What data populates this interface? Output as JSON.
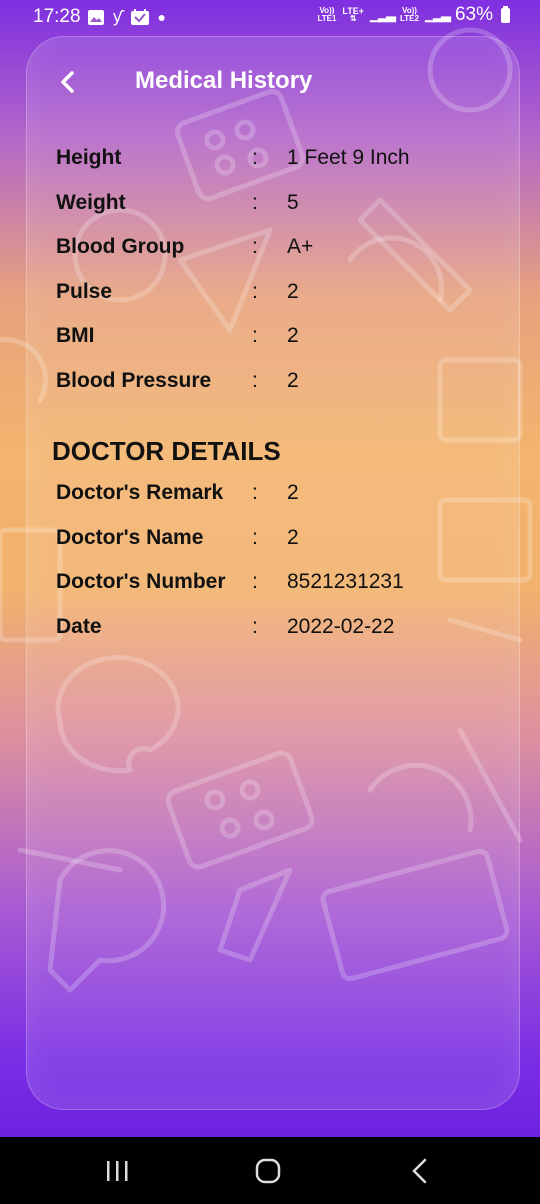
{
  "status_bar": {
    "time": "17:28",
    "left_icons": [
      "gallery-icon",
      "y-app-icon",
      "calendar-icon",
      "dot-icon"
    ],
    "net1_top": "Vo))",
    "net1_bottom": "LTE1",
    "net_mid": "LTE+",
    "net2_top": "Vo))",
    "net2_bottom": "LTE2",
    "battery": "63%"
  },
  "header": {
    "title": "Medical History",
    "back_icon": "chevron-left-icon"
  },
  "medical": [
    {
      "label": "Height",
      "value": "1 Feet 9 Inch"
    },
    {
      "label": "Weight",
      "value": "5"
    },
    {
      "label": "Blood Group",
      "value": "A+"
    },
    {
      "label": "Pulse",
      "value": "2"
    },
    {
      "label": "BMI",
      "value": "2"
    },
    {
      "label": "Blood Pressure",
      "value": "2"
    }
  ],
  "doctor_section_title": "DOCTOR DETAILS",
  "doctor": [
    {
      "label": "Doctor's Remark",
      "value": "2"
    },
    {
      "label": "Doctor's Name",
      "value": "2"
    },
    {
      "label": "Doctor's Number",
      "value": "8521231231"
    },
    {
      "label": "Date",
      "value": "2022-02-22"
    }
  ],
  "separator": ":",
  "nav_bar": {
    "recents_icon": "recents-icon",
    "home_icon": "home-icon",
    "back_icon": "back-icon"
  },
  "colors": {
    "gradient_top": "#7e2fe0",
    "gradient_mid": "#f3b46d",
    "gradient_bottom": "#6d22e0",
    "text": "#111111",
    "title": "#ffffff"
  }
}
